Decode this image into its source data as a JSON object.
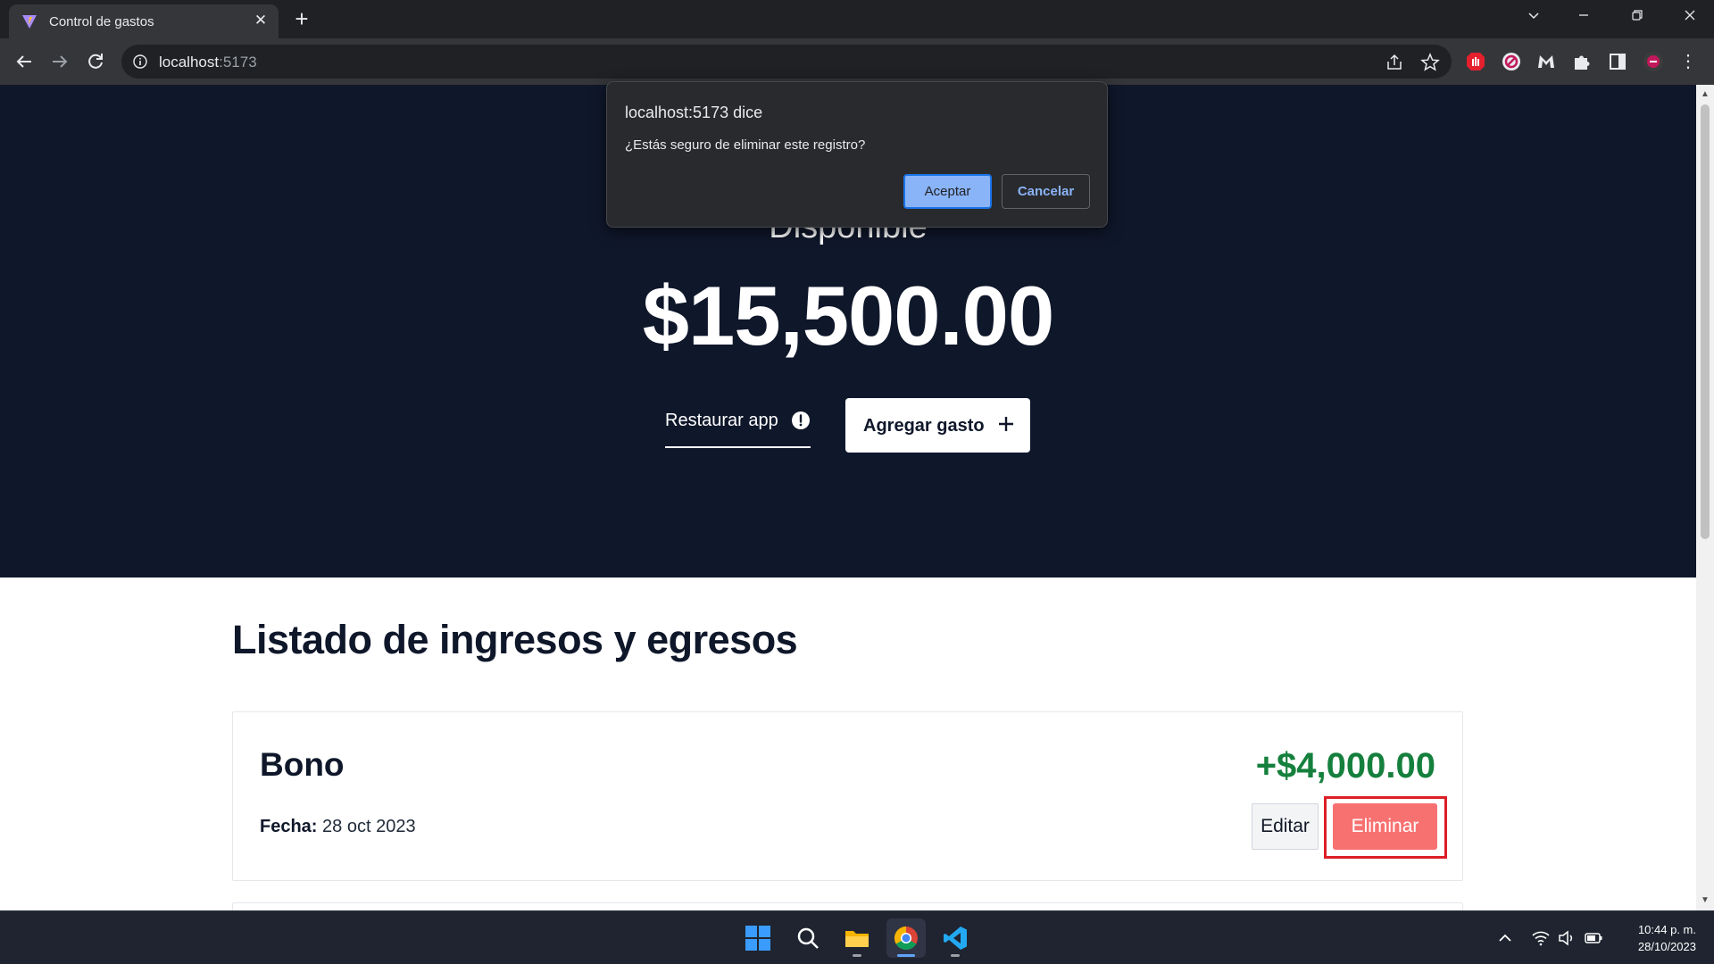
{
  "browser": {
    "tab_title": "Control de gastos",
    "url_host": "localhost",
    "url_port": ":5173"
  },
  "dialog": {
    "title": "localhost:5173 dice",
    "message": "¿Estás seguro de eliminar este registro?",
    "ok_label": "Aceptar",
    "cancel_label": "Cancelar"
  },
  "hero": {
    "heading": "Disponible",
    "amount": "$15,500.00",
    "restore_label": "Restaurar app",
    "add_label": "Agregar gasto"
  },
  "list": {
    "title": "Listado de ingresos y egresos",
    "items": [
      {
        "name": "Bono",
        "amount": "+$4,000.00",
        "date_label": "Fecha:",
        "date_value": "28 oct 2023",
        "edit_label": "Editar",
        "delete_label": "Eliminar"
      }
    ]
  },
  "taskbar": {
    "time": "10:44 p. m.",
    "date": "28/10/2023"
  },
  "colors": {
    "hero_bg": "#0f172a",
    "income": "#15803d",
    "delete_button": "#f87171",
    "highlight_box": "#dc1f26",
    "dialog_accent": "#8ab4f8"
  }
}
